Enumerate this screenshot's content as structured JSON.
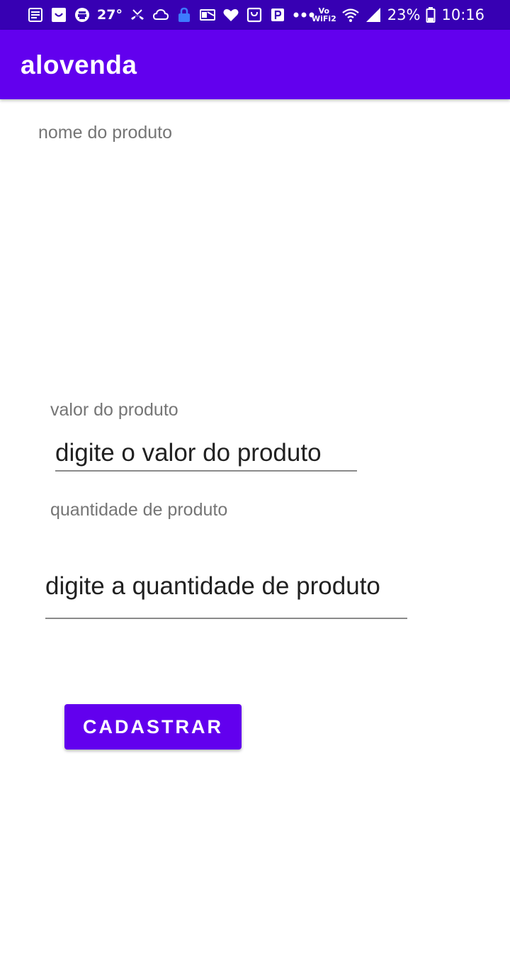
{
  "status_bar": {
    "temperature": "27°",
    "battery_percent": "23%",
    "time": "10:16",
    "network_label_top": "Vo",
    "network_label_bottom": "WiFi2",
    "left_icons": [
      "news-icon",
      "smile-box-icon",
      "printer-icon",
      "missed-call-icon",
      "cloud-icon",
      "lock-icon",
      "outlook-icon",
      "heart-icon",
      "bag-icon",
      "parking-icon",
      "more-dots-icon"
    ],
    "right_icons": [
      "vowifi-icon",
      "wifi-icon",
      "signal-icon",
      "battery-icon"
    ]
  },
  "app_bar": {
    "title": "alovenda"
  },
  "form": {
    "product_name_label": "nome do produto",
    "product_value_label": "valor do produto",
    "product_value_placeholder": "digite o valor do produto",
    "product_quantity_label": "quantidade de produto",
    "product_quantity_placeholder": "digite a quantidade de produto",
    "submit_label": "CADASTRAR"
  },
  "colors": {
    "primary": "#6200EE",
    "primary_dark": "#3700B3",
    "label_gray": "#757575",
    "text_dark": "#212121",
    "background": "#FFFFFF"
  }
}
